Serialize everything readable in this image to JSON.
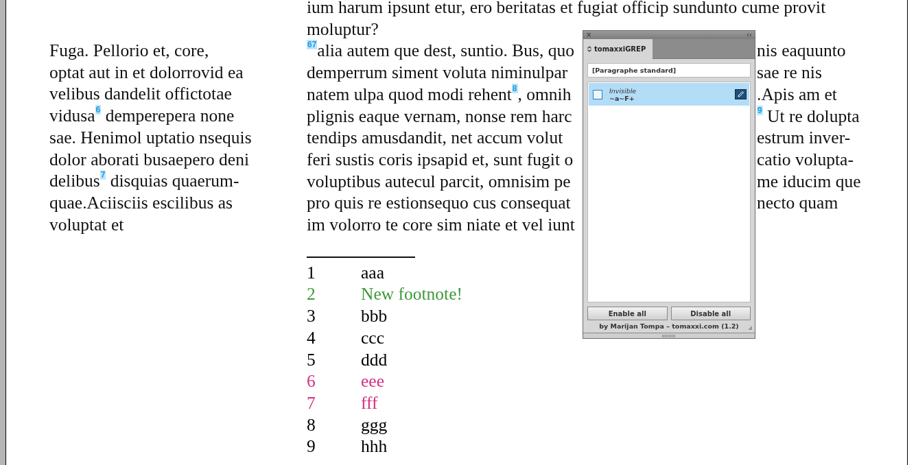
{
  "left_column": {
    "lines": [
      "Fuga. Pellorio et, core,",
      "optat aut in et dolorrovid ea",
      "velibus dandelit offictotae",
      "vidusa$^{6}$ demperepera none",
      "sae. Henimol uptatio nsequis",
      "dolor aborati busaepero deni",
      "delibus$^{7}$ disquias quaerum-",
      "quae.Aciisciis escilibus as",
      "voluptat et"
    ]
  },
  "right_column": {
    "full_lines": [
      "ium harum ipsunt etur, ero beritatas et fugiat officip sundunto cume provit",
      "moluptur?"
    ],
    "split_lines": [
      {
        "left": "$^{67}$alia autem que dest, suntio. Bus, quo",
        "right": "nis eaquunto"
      },
      {
        "left": "demperrum siment voluta niminulpar",
        "right": "sae re nis"
      },
      {
        "left": "natem ulpa quod modi rehent$^{8}$, omnih",
        "right": ".Apis am et"
      },
      {
        "left": "plignis eaque vernam, nonse rem harc",
        "right": "$^{9}$ Ut re dolupta"
      },
      {
        "left": "tendips amusdandit, net accum volut",
        "right": "estrum inver-"
      },
      {
        "left": "feri sustis coris ipsapid et, sunt fugit o",
        "right": "catio volupta-"
      },
      {
        "left": "voluptibus autecul parcit, omnisim pe",
        "right": "me iducim que"
      },
      {
        "left": "pro quis re estionsequo cus consequat",
        "right": "necto quam"
      },
      {
        "left": "im volorro te core sim niate et vel iunt"
      }
    ]
  },
  "footnotes": [
    {
      "number": "1",
      "text": "aaa",
      "color": "#000000"
    },
    {
      "number": "2",
      "text": "New footnote!",
      "color": "#3f9a3a"
    },
    {
      "number": "3",
      "text": "bbb",
      "color": "#000000"
    },
    {
      "number": "4",
      "text": "ccc",
      "color": "#000000"
    },
    {
      "number": "5",
      "text": "ddd",
      "color": "#000000"
    },
    {
      "number": "6",
      "text": "eee",
      "color": "#d4307f"
    },
    {
      "number": "7",
      "text": "fff",
      "color": "#d4307f"
    },
    {
      "number": "8",
      "text": "ggg",
      "color": "#000000"
    },
    {
      "number": "9",
      "text": "hhh",
      "color": "#000000"
    }
  ],
  "panel": {
    "close": "×",
    "collapse": "‹‹",
    "tabs": [
      {
        "label": "tomaxxiGREP",
        "selected": true
      }
    ],
    "style_field": {
      "value": "[Paragraphe standard]"
    },
    "rules": [
      {
        "name": "Invisible",
        "pattern": "~a~F+",
        "checked": false,
        "selected": true
      }
    ],
    "buttons": [
      "Enable all",
      "Disable all"
    ],
    "credit": "by Marijan Tompa – tomaxxi.com (1.2)"
  }
}
